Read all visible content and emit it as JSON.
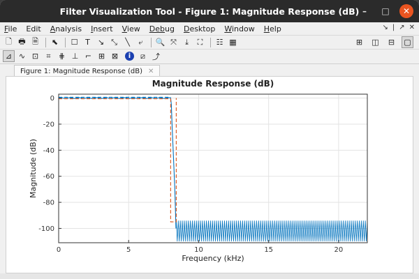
{
  "window": {
    "title": "Filter Visualization Tool - Figure 1: Magnitude Response (dB)",
    "controls": {
      "minimize": "–",
      "maximize": "□",
      "close": "✕"
    }
  },
  "menu": {
    "items": [
      {
        "label": "File",
        "underline": "F",
        "rest": "ile"
      },
      {
        "label": "Edit",
        "underline": "",
        "rest": "Edit"
      },
      {
        "label": "Analysis",
        "underline": "A",
        "rest": "nalysis"
      },
      {
        "label": "Insert",
        "underline": "I",
        "rest": "nsert"
      },
      {
        "label": "View",
        "underline": "V",
        "rest": "iew"
      },
      {
        "label": "Debug",
        "underline": "Deb",
        "rest": "ug"
      },
      {
        "label": "Desktop",
        "underline": "D",
        "rest": "esktop"
      },
      {
        "label": "Window",
        "underline": "W",
        "rest": "indow"
      },
      {
        "label": "Help",
        "underline": "H",
        "rest": "elp"
      }
    ],
    "right": [
      "↘",
      "|",
      "↗",
      "✕"
    ]
  },
  "toolbar1": {
    "icons": [
      "new-file-icon",
      "print-icon",
      "print-preview-icon",
      "pointer-icon",
      "rectangle-icon",
      "text-icon",
      "arrow-icon",
      "double-arrow-icon",
      "line-icon",
      "pin-icon",
      "zoom-in-icon",
      "pan-icon",
      "data-cursor-icon",
      "fit-icon",
      "legend-icon",
      "colorbar-icon"
    ],
    "glyphs": [
      "🗋",
      "🖶",
      "🗎",
      "⬉",
      "☐",
      "T",
      "↘",
      "⤡",
      "╲",
      "⤶",
      "🔍",
      "⤧",
      "⤓",
      "⛶",
      "☷",
      "▦"
    ],
    "layout_glyphs": [
      "⊞",
      "◫",
      "⊟",
      "▢"
    ]
  },
  "toolbar2": {
    "icons": [
      "magnitude-icon",
      "phase-icon",
      "mag-phase-icon",
      "group-delay-icon",
      "phase-delay-icon",
      "impulse-icon",
      "step-icon",
      "pole-zero-icon",
      "coefficients-icon",
      "info-icon",
      "noise-icon",
      "spectrum-icon"
    ],
    "glyphs": [
      "⊿",
      "∿",
      "⊡",
      "⌗",
      "⋕",
      "⊥",
      "⌐",
      "⊞",
      "⊠",
      "i",
      "⧄",
      "⤴"
    ]
  },
  "tab": {
    "label": "Figure 1: Magnitude Response (dB)",
    "close": "✕"
  },
  "chart_data": {
    "type": "line",
    "title": "Magnitude Response (dB)",
    "xlabel": "Frequency (kHz)",
    "ylabel": "Magnitude (dB)",
    "xlim": [
      0,
      22.05
    ],
    "ylim": [
      -111,
      3
    ],
    "xticks": [
      0,
      5,
      10,
      15,
      20
    ],
    "yticks": [
      0,
      -20,
      -40,
      -60,
      -80,
      -100
    ],
    "grid": true,
    "series": [
      {
        "color": "#0072bd",
        "style": "solid",
        "passband_edge_khz": 8.0,
        "transition": [
          [
            8.0,
            0
          ],
          [
            8.05,
            -5
          ],
          [
            8.1,
            -20
          ],
          [
            8.2,
            -45
          ],
          [
            8.3,
            -70
          ],
          [
            8.38,
            -100
          ]
        ],
        "stopband_start_khz": 8.4,
        "stopband_db_range": [
          -110,
          -94
        ]
      },
      {
        "color": "#d95319",
        "style": "dashed",
        "points": [
          [
            0,
            -0.5
          ],
          [
            8.0,
            -0.5
          ],
          [
            8.0,
            -95
          ],
          [
            8.4,
            -95
          ],
          [
            8.4,
            0
          ]
        ]
      },
      {
        "color": "#0072bd",
        "style": "dashed",
        "points": [
          [
            0,
            0.6
          ],
          [
            8.0,
            0.6
          ]
        ]
      }
    ]
  }
}
